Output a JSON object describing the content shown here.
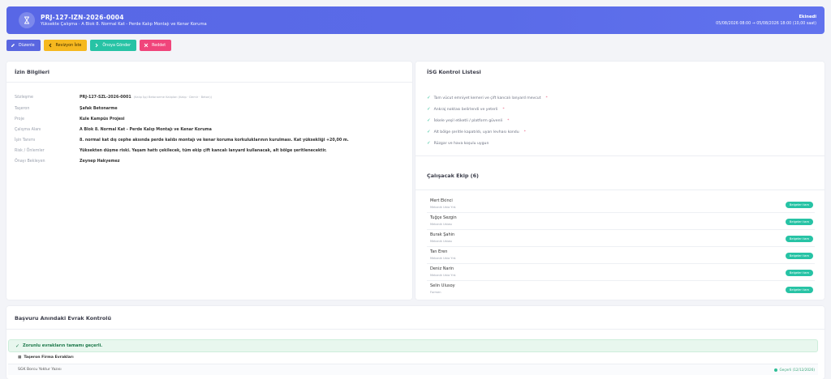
{
  "header": {
    "permit_code": "PRJ-127-IZN-2026-0004",
    "subtitle": "Yüksekte Çalışma · A Blok 8. Normal Kat - Perde Kalıp Montajı ve Kenar Koruma",
    "status": "Ekinedi",
    "dates": "05/08/2026 08:00 → 05/08/2026 18:00 (10,00 saat)",
    "icon": "permit-icon"
  },
  "actions": [
    {
      "label": "Düzenle",
      "icon": "edit-icon",
      "color": "#5966e0"
    },
    {
      "label": "Revizyon İste",
      "icon": "arrow-left-icon",
      "color": "#f6b81f"
    },
    {
      "label": "Önoya Gönder",
      "icon": "arrow-right-icon",
      "color": "#27c3a5"
    },
    {
      "label": "Reddet",
      "icon": "close-icon",
      "color": "#f0457b"
    }
  ],
  "info": {
    "title": "İzin Bilgileri",
    "rows": [
      {
        "label": "Sözleşme",
        "value": "PRJ-127-SZL-2026-0001",
        "note": "(Kalıp İşçi Betonarme Kalıpları (Kalıp · Demir · Beton))"
      },
      {
        "label": "Taşeron",
        "value": "Şafak Betonarme",
        "note": ""
      },
      {
        "label": "Proje",
        "value": "Kule Kampüs Projesi",
        "note": ""
      },
      {
        "label": "Çalışma Alanı",
        "value": "A Blok 8. Normal Kat - Perde Kalıp Montajı ve Kenar Koruma",
        "note": ""
      },
      {
        "label": "İşin Tanımı",
        "value": "8. normal kat dış cephe aksında perde kalıbı montajı ve kenar koruma korkuluklarının kurulması. Kat yüksekliği +20,00 m.",
        "note": ""
      },
      {
        "label": "Risk / Önlemler",
        "value": "Yüksekten düşme riski. Yaşam hattı çekilecek, tüm ekip çift kancalı lanyard kullanacak, alt bölge şeritlenecektir.",
        "note": ""
      },
      {
        "label": "Önayı Bekleyen",
        "value": "Zeynep Hakyemez",
        "note": ""
      }
    ]
  },
  "isg": {
    "title": "İSG Kontrol Listesi",
    "items": [
      {
        "text": "Tam vücut emniyet kemeri ve çift kancalı lanyard mevcut",
        "required": "*"
      },
      {
        "text": "Ankraj noktası belirlendi ve yeterli",
        "required": "*"
      },
      {
        "text": "İskele yeşil etiketli / platform güvenli",
        "required": "*"
      },
      {
        "text": "Alt bölge şeritle kapatıldı, uyarı levhası kondu",
        "required": "*"
      },
      {
        "text": "Rüzgar ve hava koşulu uygun",
        "required": ""
      }
    ]
  },
  "team": {
    "title": "Çalışacak Ekip (6)",
    "badge_label": "Belgeleri tam",
    "members": [
      {
        "name": "Mert Ekinci",
        "role": "Mekanik Usta Yrd."
      },
      {
        "name": "Tuğçe Sezgin",
        "role": "Mekanik Ustası"
      },
      {
        "name": "Burak Şahin",
        "role": "Mekanik Ustası"
      },
      {
        "name": "Tan Eren",
        "role": "Mekanik Usta Yrd."
      },
      {
        "name": "Deniz Narin",
        "role": "Mekanik Usta Yrd."
      },
      {
        "name": "Selin Ulusoy",
        "role": "Formen"
      }
    ]
  },
  "docs": {
    "title": "Başvuru Anındaki Evrak Kontrolü",
    "alert": "Zorunlu evrakların tamamı geçerli.",
    "group": "Taşeron Firma Evrakları",
    "row_name": "SGK Borcu Yoktur Yazısı",
    "row_status": "Geçerli (12/12/2026)"
  },
  "colors": {
    "accent": "#5966e0",
    "success": "#27c3a5",
    "warning": "#f6b81f",
    "danger": "#f0457b"
  }
}
